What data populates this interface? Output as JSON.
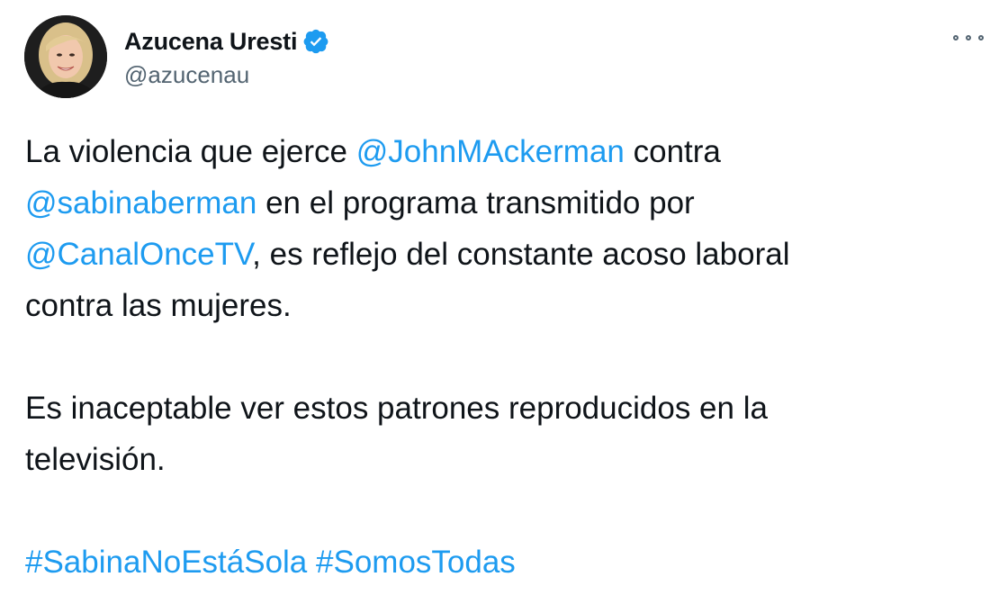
{
  "author": {
    "name": "Azucena Uresti",
    "handle": "@azucenau",
    "verified_icon": "verified-badge-icon",
    "avatar_icon": "profile-photo"
  },
  "menu": {
    "icon": "more-options-icon"
  },
  "tweet": {
    "p1": {
      "t1": "La violencia que ejerce ",
      "m1": "@JohnMAckerman",
      "t2": " contra",
      "m2": "@sabinaberman",
      "t3": " en el programa transmitido por",
      "m3": "@CanalOnceTV",
      "t4": ", es reflejo del constante acoso laboral",
      "t5": "contra las mujeres."
    },
    "p2": {
      "line1": "Es inaceptable ver estos patrones reproducidos en la",
      "line2": "televisión."
    },
    "hashtags": [
      "#SabinaNoEstáSola",
      "#SomosTodas"
    ]
  },
  "colors": {
    "link": "#1d9bf0",
    "text": "#0f1419",
    "secondary": "#536471"
  }
}
